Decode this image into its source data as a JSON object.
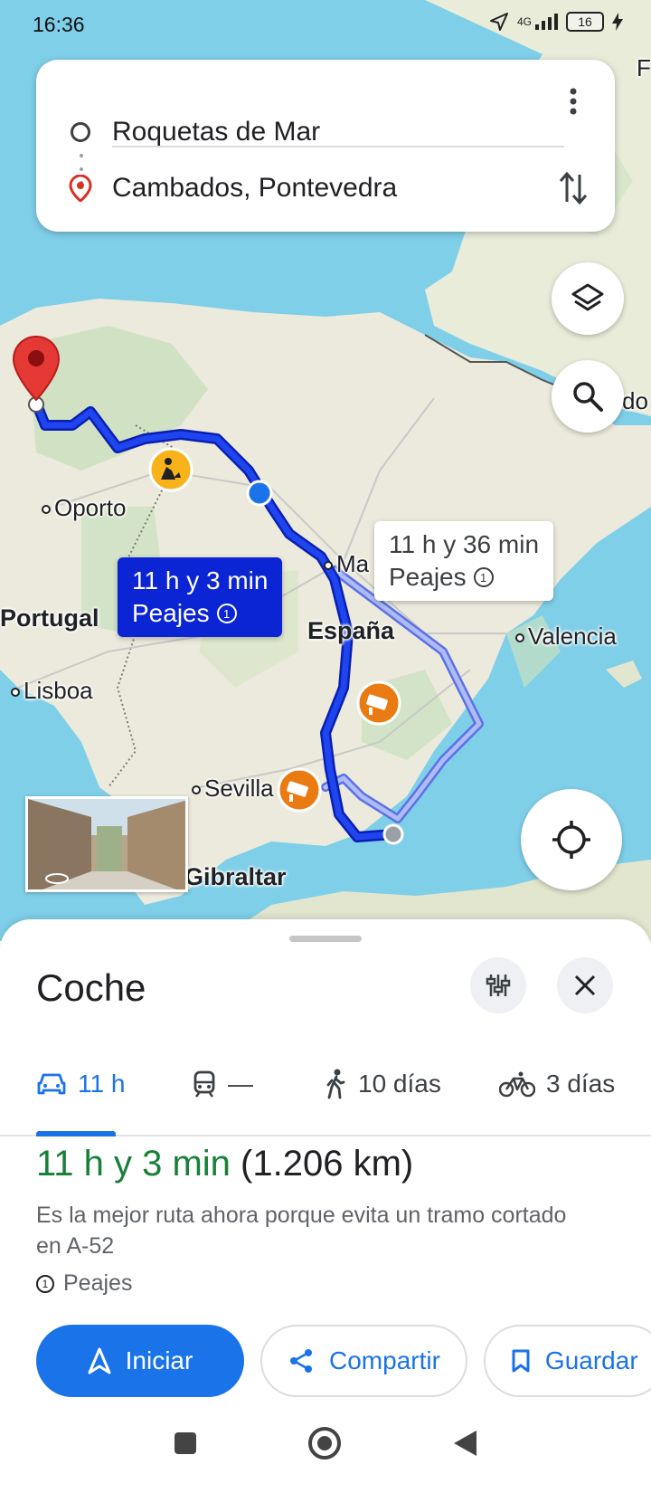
{
  "status_bar": {
    "time": "16:36",
    "network": "4G",
    "battery": "16"
  },
  "route_card": {
    "origin": "Roquetas de Mar",
    "destination": "Cambados, Pontevedra"
  },
  "map": {
    "labels": {
      "oporto": "Oporto",
      "portugal": "Portugal",
      "lisboa": "Lisboa",
      "madrid_partial": "Ma",
      "espana": "España",
      "valencia": "Valencia",
      "sevilla_partial": "Sevilla",
      "gibraltar": "Gibraltar",
      "edge_top_right": "F",
      "edge_right": "do"
    },
    "primary_route_bubble": {
      "duration": "11 h y 3 min",
      "tolls": "Peajes"
    },
    "alt_route_bubble": {
      "duration": "11 h y 36 min",
      "tolls": "Peajes"
    },
    "colors": {
      "primary_route": "#1a3fe0",
      "alt_route": "#8fa4f5",
      "water": "#7fcfe9",
      "land": "#f1efe4"
    }
  },
  "sheet": {
    "title": "Coche",
    "modes": [
      {
        "icon": "car-icon",
        "label": "11 h",
        "active": true
      },
      {
        "icon": "train-icon",
        "label": "—",
        "active": false
      },
      {
        "icon": "walk-icon",
        "label": "10 días",
        "active": false
      },
      {
        "icon": "bike-icon",
        "label": "3 días",
        "active": false
      }
    ],
    "summary_duration": "11 h y 3 min",
    "summary_distance": "(1.206 km)",
    "reason": "Es la mejor ruta ahora porque evita un tramo cortado en A-52",
    "tolls": "Peajes",
    "actions": {
      "start": "Iniciar",
      "share": "Compartir",
      "save": "Guardar"
    },
    "accent": "#1a73e8",
    "duration_color": "#188038"
  }
}
